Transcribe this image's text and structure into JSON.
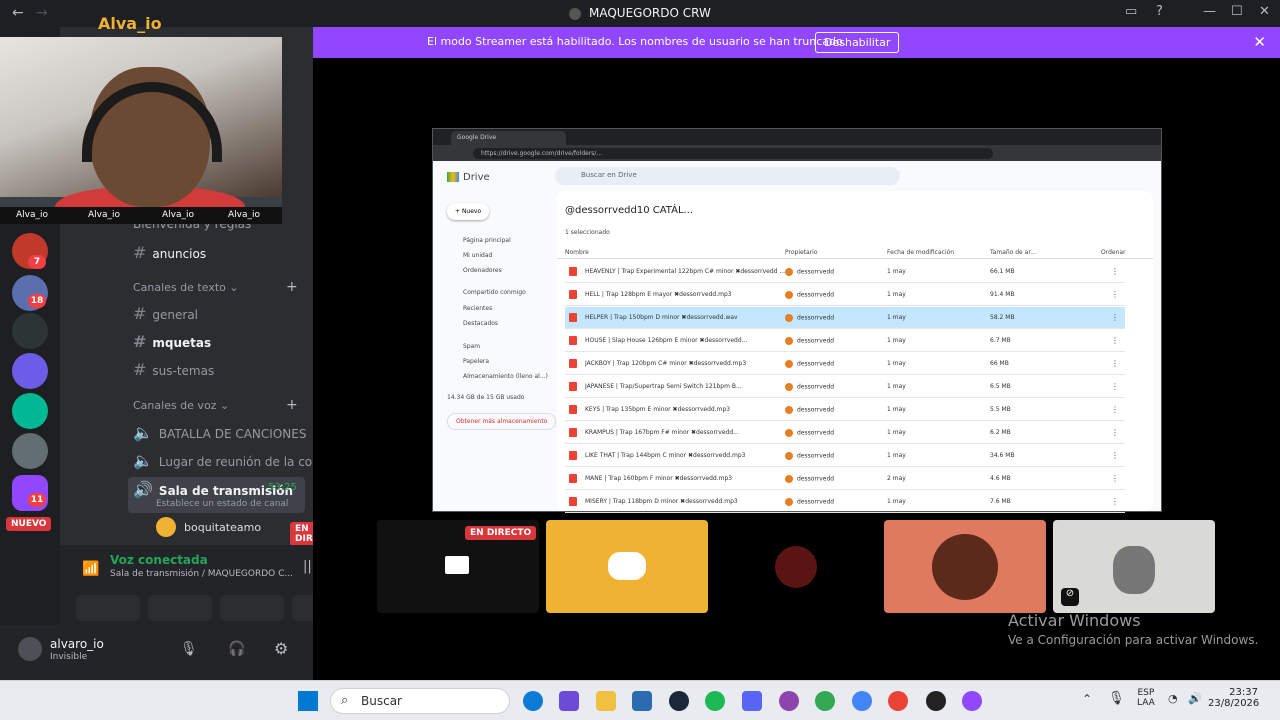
{
  "window": {
    "title": "MAQUEGORDO CRW",
    "back": "←",
    "forward": "→",
    "minimize": "—",
    "maximize": "☐",
    "close": "✕"
  },
  "streamer_banner": {
    "message": "El modo Streamer está habilitado. Los nombres de usuario se han truncado.",
    "button": "Deshabilitar",
    "close": "✕"
  },
  "server_rail": {
    "badges": [
      "7",
      "18",
      "11"
    ],
    "new_badge": "NUEVO"
  },
  "channels": {
    "stream_overlay_title": "Alva_io",
    "cam_socials": [
      "Alva_io",
      "Alva_io",
      "Alva_io",
      "Alva_io"
    ],
    "partial_channel": "Bienvenida y reglas",
    "announcements": "anuncios",
    "text_category": "Canales de texto",
    "text_channels": [
      {
        "label": "general",
        "active": false
      },
      {
        "label": "mquetas",
        "active": true
      },
      {
        "label": "sus-temas",
        "active": false
      }
    ],
    "voice_category": "Canales de voz",
    "voice_channels": [
      "BATALLA DE CANCIONES",
      "Lugar de reunión de la comunidad"
    ],
    "stream_channel": {
      "label": "Sala de transmisión",
      "time": "53:25",
      "status_prompt": "Establece un estado de canal",
      "member": "boquitateamo",
      "live": "EN DIRECTO"
    }
  },
  "voice_panel": {
    "status": "Voz conectada",
    "channel": "Sala de transmisión / MAQUEGORDO C..."
  },
  "user_panel": {
    "username": "alvaro_io",
    "status": "Invisible"
  },
  "browser": {
    "tab_title": "Google Drive",
    "url": "https://drive.google.com/drive/folders/...",
    "drive": {
      "product": "Drive",
      "search_placeholder": "Buscar en Drive",
      "new_button": "Nuevo",
      "folder_title": "@dessorrvedd10 CATÁL...",
      "sidebar": [
        "Página principal",
        "Mi unidad",
        "Ordenadores",
        "Compartido conmigo",
        "Recientes",
        "Destacados",
        "Spam",
        "Papelera",
        "Almacenamiento (lleno al...)",
        "14.34 GB de 15 GB usado",
        "Obtener más almacenamiento"
      ],
      "filter_label": "1 seleccionado",
      "columns": [
        "Nombre",
        "Propietario",
        "Fecha de modificación",
        "Tamaño de ar...",
        "Ordenar"
      ],
      "rows": [
        {
          "name": "HEAVENLY | Trap Experimental 122bpm C# minor ✖dessorrvedd ...",
          "owner": "dessorrvedd",
          "date": "1 may",
          "size": "66.1 MB",
          "selected": false
        },
        {
          "name": "HELL | Trap 128bpm E mayor ✖dessorrvedd.mp3",
          "owner": "dessorrvedd",
          "date": "1 may",
          "size": "91.4 MB",
          "selected": false
        },
        {
          "name": "HELPER | Trap 150bpm D minor ✖dessorrvedd.wav",
          "owner": "dessorrvedd",
          "date": "1 may",
          "size": "58.2 MB",
          "selected": true
        },
        {
          "name": "HOUSE | Slap House 126bpm E minor ✖dessorrvedd...",
          "owner": "dessorrvedd",
          "date": "1 may",
          "size": "6.7 MB",
          "selected": false
        },
        {
          "name": "JACKBOY | Trap 120bpm C# minor ✖dessorrvedd.mp3",
          "owner": "dessorrvedd",
          "date": "1 may",
          "size": "66 MB",
          "selected": false
        },
        {
          "name": "JAPANESE | Trap/Supertrap Semi Switch 121bpm B...",
          "owner": "dessorrvedd",
          "date": "1 may",
          "size": "6.5 MB",
          "selected": false
        },
        {
          "name": "KEYS | Trap 135bpm E minor ✖dessorrvedd.mp3",
          "owner": "dessorrvedd",
          "date": "1 may",
          "size": "5.5 MB",
          "selected": false
        },
        {
          "name": "KRAMPUS | Trap 167bpm F# minor ✖dessorrvedd...",
          "owner": "dessorrvedd",
          "date": "1 may",
          "size": "6.2 MB",
          "selected": false
        },
        {
          "name": "LIKE THAT | Trap 144bpm C minor ✖dessorrvedd.mp3",
          "owner": "dessorrvedd",
          "date": "1 may",
          "size": "34.6 MB",
          "selected": false
        },
        {
          "name": "MANE | Trap 160bpm F minor ✖dessorrvedd.mp3",
          "owner": "dessorrvedd",
          "date": "2 may",
          "size": "4.6 MB",
          "selected": false
        },
        {
          "name": "MISERY | Trap 118bpm D minor ✖dessorrvedd.mp3",
          "owner": "dessorrvedd",
          "date": "1 may",
          "size": "7.6 MB",
          "selected": false
        }
      ]
    }
  },
  "participants": {
    "live": "EN DIRECTO"
  },
  "watermark": {
    "title": "Activar Windows",
    "subtitle": "Ve a Configuración para activar Windows."
  },
  "taskbar": {
    "search": "Buscar",
    "lang": "ESP",
    "layout": "LAA",
    "time": "23:37",
    "date": "23/8/2026"
  },
  "colors": {
    "streamer": "#9146ff",
    "discord": "#5865f2",
    "live": "#da373c",
    "voice_green": "#23a55a"
  }
}
